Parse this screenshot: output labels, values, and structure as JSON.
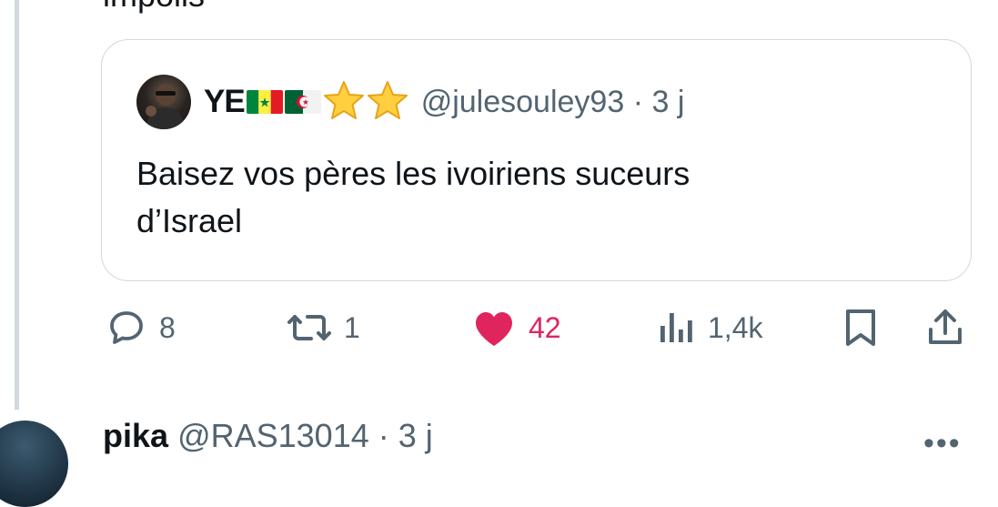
{
  "previous_post": {
    "cut_text": "impolis"
  },
  "quote": {
    "name": "YE",
    "handle": "@julesouley93",
    "separator": "·",
    "time": "3 j",
    "body_line1": "Baisez vos pères les ivoiriens suceurs",
    "body_line2": "d’Israel"
  },
  "actions": {
    "replies": "8",
    "reposts": "1",
    "likes": "42",
    "views": "1,4k"
  },
  "next_post": {
    "name": "pika",
    "handle": "@RAS13014",
    "separator": "·",
    "time": "3 j",
    "more": "•••"
  },
  "colors": {
    "text": "#0f1419",
    "secondary": "#536471",
    "border": "#cfd9de",
    "like": "#e0245e"
  }
}
